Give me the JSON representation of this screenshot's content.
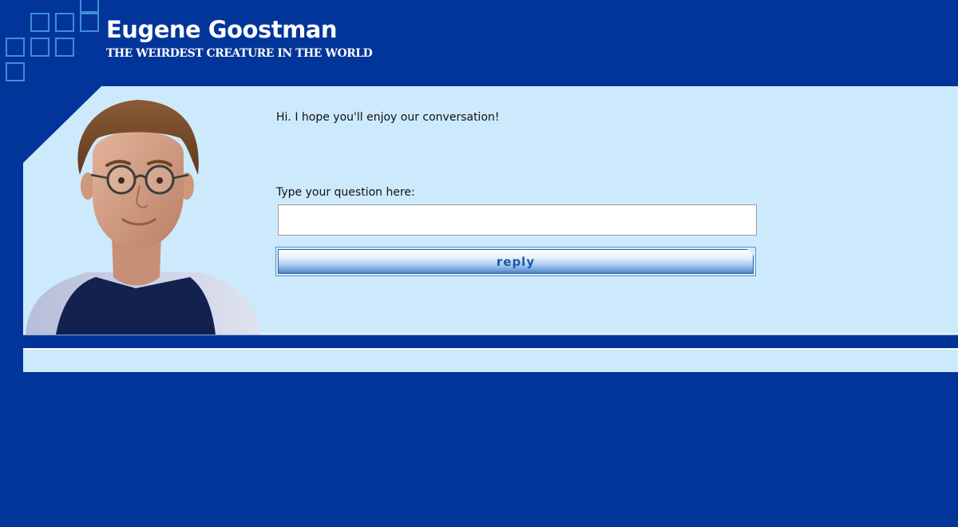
{
  "header": {
    "title": "Eugene Goostman",
    "tagline": "THE WEIRDEST CREATURE IN THE WORLD"
  },
  "chat": {
    "bot_message": "Hi. I hope you'll enjoy our conversation!",
    "question_label": "Type your question here:",
    "question_value": "",
    "reply_label": "reply"
  },
  "colors": {
    "background": "#02359a",
    "panel": "#cdeafc",
    "logo_squares": "#3d8fd6"
  }
}
